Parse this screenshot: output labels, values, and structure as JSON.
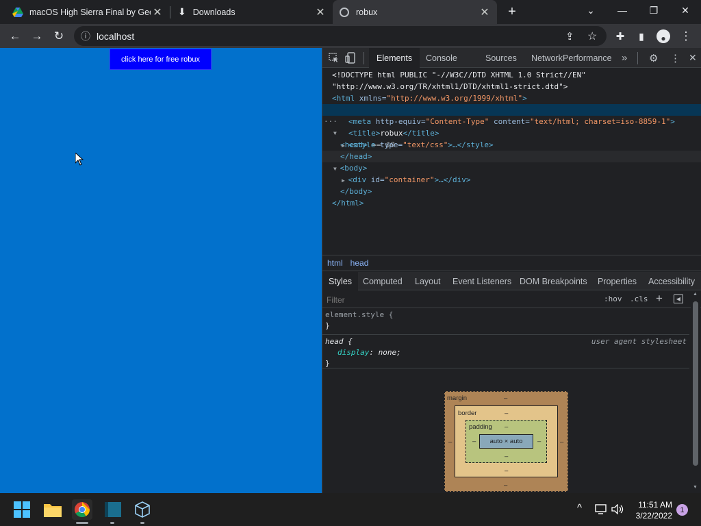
{
  "tabs": [
    {
      "title": "macOS High Sierra Final by Geek",
      "close": "✕"
    },
    {
      "title": "Downloads",
      "close": "✕"
    },
    {
      "title": "robux",
      "close": "✕"
    }
  ],
  "new_tab": "+",
  "window_controls": {
    "tab_search": "⌄",
    "minimize": "—",
    "restore": "❐",
    "close": "✕"
  },
  "toolbar": {
    "back": "←",
    "forward": "→",
    "reload": "↻",
    "info": "ⓘ",
    "url": "localhost",
    "share": "⇪",
    "bookmark": "☆",
    "extensions": "✚",
    "sidepanel": "▮",
    "profile": "●",
    "menu": "⋮"
  },
  "page": {
    "button_label": "click here for free robux",
    "background": "#0271cc",
    "button_color": "#0000ff"
  },
  "devtools": {
    "tabs": [
      "Elements",
      "Console",
      "Sources",
      "Network",
      "Performance"
    ],
    "more": "»",
    "settings": "⚙",
    "dots": "⋮",
    "close": "✕",
    "dom": {
      "l1": "<!DOCTYPE html PUBLIC \"-//W3C//DTD XHTML 1.0 Strict//EN\"",
      "l2": "\"http://www.w3.org/TR/xhtml1/DTD/xhtml1-strict.dtd\">",
      "html_open": "<html",
      "xmlns_attr": " xmlns=",
      "xmlns_val": "\"http://www.w3.org/1999/xhtml\"",
      "close_gt": ">",
      "head_open": "<head>",
      "head_marker": " == $0",
      "ellipsis": "···",
      "meta_open": "<meta",
      "meta_attr1": " http-equiv=",
      "meta_val1": "\"Content-Type\"",
      "meta_attr2": " content=",
      "meta_val2": "\"text/html; charset=iso-8859-1\"",
      "title_open": "<title>",
      "title_text": "robux",
      "title_close": "</title>",
      "style_open": "<style",
      "style_attr": " type=",
      "style_val": "\"text/css\"",
      "style_rest": ">…</style>",
      "head_close": "</head>",
      "body_open": "<body>",
      "div_open": "<div",
      "div_attr": " id=",
      "div_val": "\"container\"",
      "div_rest": ">…</div>",
      "body_close": "</body>",
      "html_close": "</html>"
    },
    "breadcrumbs": [
      "html",
      "head"
    ],
    "style_tabs": [
      "Styles",
      "Computed",
      "Layout",
      "Event Listeners",
      "DOM Breakpoints",
      "Properties",
      "Accessibility"
    ],
    "filter_placeholder": "Filter",
    "hov": ":hov",
    "cls": ".cls",
    "plus": "+",
    "element_style": "element.style {",
    "brace_close": "}",
    "head_rule": "head {",
    "user_agent": "user agent stylesheet",
    "prop_name": "display",
    "prop_value": "none;",
    "box": {
      "margin": "margin",
      "border": "border",
      "padding": "padding",
      "content": "auto × auto",
      "dash": "–"
    }
  },
  "taskbar": {
    "time": "11:51 AM",
    "date": "3/22/2022",
    "notifications": "1",
    "chevron": "^"
  }
}
